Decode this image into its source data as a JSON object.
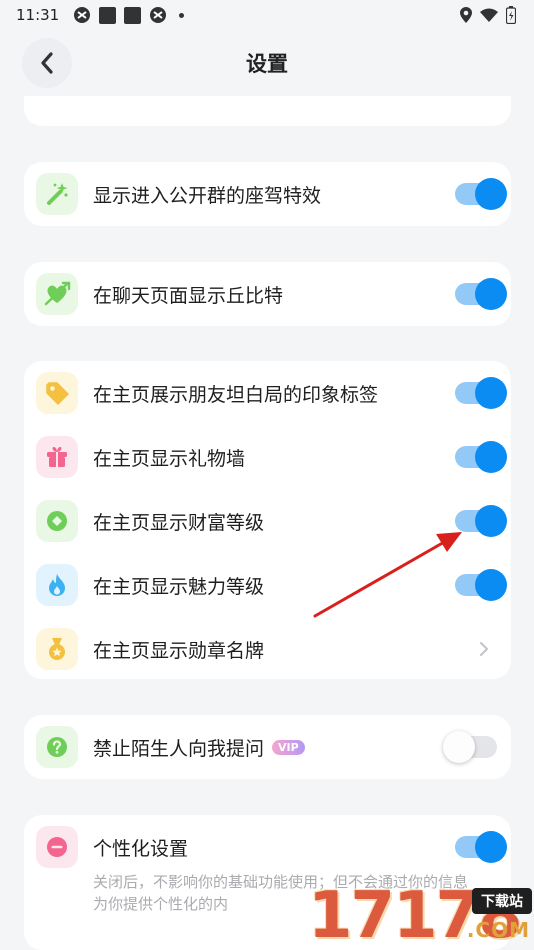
{
  "status_bar": {
    "time": "11:31"
  },
  "header": {
    "title": "设置"
  },
  "cards": [
    {
      "rows": [
        {
          "label": "显示进入公开群的座驾特效",
          "icon": "magic-wand-icon",
          "control": "toggle",
          "checked": true
        }
      ]
    },
    {
      "rows": [
        {
          "label": "在聊天页面显示丘比特",
          "icon": "cupid-heart-icon",
          "control": "toggle",
          "checked": true
        }
      ]
    },
    {
      "rows": [
        {
          "label": "在主页展示朋友坦白局的印象标签",
          "icon": "tag-icon",
          "control": "toggle",
          "checked": true
        },
        {
          "label": "在主页显示礼物墙",
          "icon": "gift-icon",
          "control": "toggle",
          "checked": true
        },
        {
          "label": "在主页显示财富等级",
          "icon": "wealth-coin-icon",
          "control": "toggle",
          "checked": true
        },
        {
          "label": "在主页显示魅力等级",
          "icon": "flame-icon",
          "control": "toggle",
          "checked": true
        },
        {
          "label": "在主页显示勋章名牌",
          "icon": "medal-icon",
          "control": "chevron"
        }
      ]
    },
    {
      "rows": [
        {
          "label": "禁止陌生人向我提问",
          "badge": "VIP",
          "icon": "question-icon",
          "control": "toggle",
          "checked": false
        }
      ]
    },
    {
      "rows": [
        {
          "label": "个性化设置",
          "icon": "minus-circle-icon",
          "control": "toggle",
          "checked": true,
          "description": "关闭后，不影响你的基础功能使用；但不会通过你的信息为你提供个性化的内"
        }
      ]
    }
  ],
  "watermark": {
    "digits": "17178",
    "tag": "下载站",
    "suffix": ".COM"
  },
  "colors": {
    "toggle_on_knob": "#0a8cf2",
    "toggle_on_track": "#93c9f6",
    "annotation_arrow": "#d8201c"
  }
}
